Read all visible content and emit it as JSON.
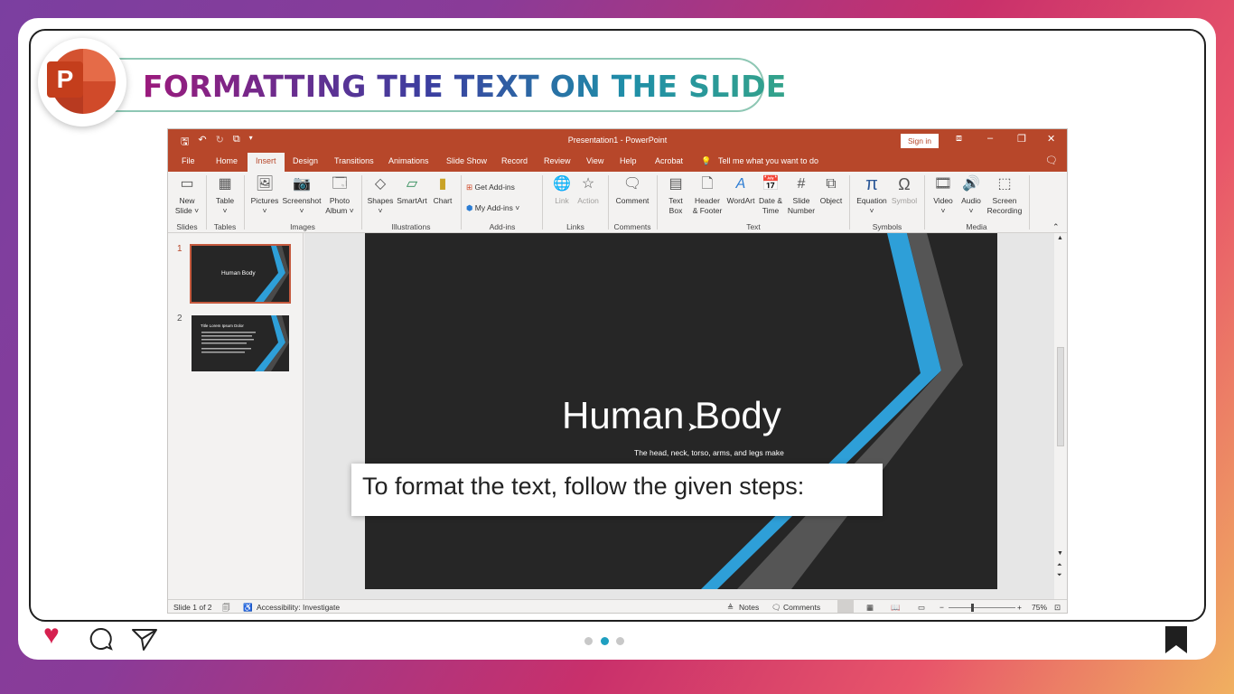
{
  "header": {
    "title": "FORMATTING THE TEXT ON THE SLIDE",
    "logo_letter": "P"
  },
  "window": {
    "title": "Presentation1 - PowerPoint",
    "sign_in": "Sign in"
  },
  "tabs": [
    "File",
    "Home",
    "Insert",
    "Design",
    "Transitions",
    "Animations",
    "Slide Show",
    "Record",
    "Review",
    "View",
    "Help",
    "Acrobat"
  ],
  "active_tab": "Insert",
  "tell_me": "Tell me what you want to do",
  "ribbon": {
    "new_slide": [
      "New",
      "Slide ˅"
    ],
    "table": [
      "Table",
      "˅"
    ],
    "pictures": [
      "Pictures",
      "˅"
    ],
    "screenshot": [
      "Screenshot",
      "˅"
    ],
    "photo_album": [
      "Photo",
      "Album ˅"
    ],
    "shapes": [
      "Shapes",
      "˅"
    ],
    "smartart": "SmartArt",
    "chart": "Chart",
    "get_addins": "Get Add-ins",
    "my_addins": "My Add-ins",
    "link": "Link",
    "action": "Action",
    "comment": "Comment",
    "text_box": [
      "Text",
      "Box"
    ],
    "header_footer": [
      "Header",
      "& Footer"
    ],
    "wordart": "WordArt",
    "date_time": [
      "Date &",
      "Time"
    ],
    "slide_number": [
      "Slide",
      "Number"
    ],
    "object": "Object",
    "equation": [
      "Equation",
      "˅"
    ],
    "symbol": "Symbol",
    "video": [
      "Video",
      "˅"
    ],
    "audio": [
      "Audio",
      "˅"
    ],
    "screen_recording": [
      "Screen",
      "Recording"
    ]
  },
  "groups": {
    "slides": "Slides",
    "tables": "Tables",
    "images": "Images",
    "illustrations": "Illustrations",
    "addins": "Add-ins",
    "links": "Links",
    "comments": "Comments",
    "text": "Text",
    "symbols": "Symbols",
    "media": "Media"
  },
  "thumbnails": [
    {
      "num": "1",
      "title": "Human Body"
    },
    {
      "num": "2",
      "title": "Title Lorem Ipsum Dolor"
    }
  ],
  "slide": {
    "title": "Human Body",
    "subtitle": "The head, neck, torso, arms, and legs make"
  },
  "tooltip": "To format the text, follow the given steps:",
  "status": {
    "slide_count": "Slide 1 of 2",
    "accessibility": "Accessibility: Investigate",
    "notes": "Notes",
    "comments": "Comments",
    "zoom": "75%"
  },
  "colors": {
    "accent": "#b7472a",
    "slide_bg": "#262626",
    "blue_band": "#2e9fd8"
  }
}
